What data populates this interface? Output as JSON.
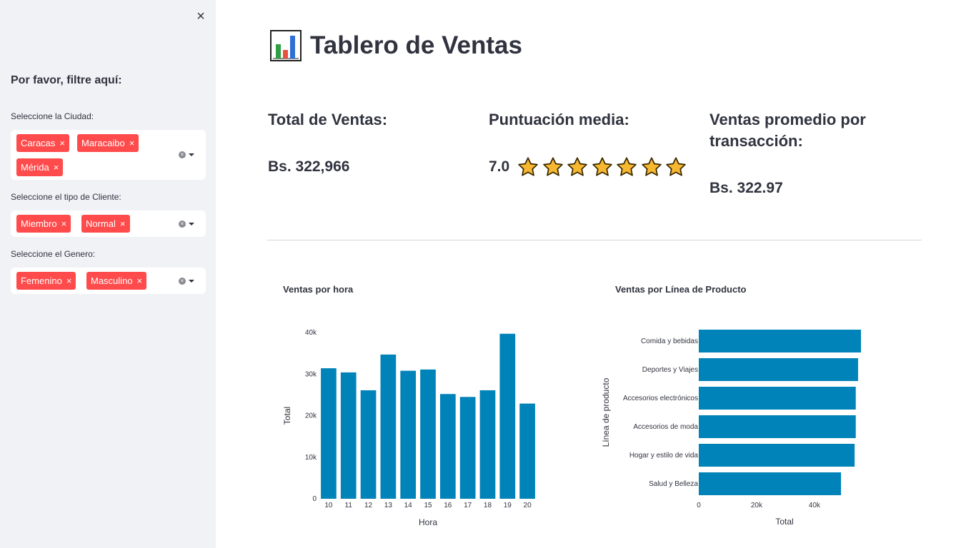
{
  "sidebar": {
    "header": "Por favor, filtre aquí:",
    "close_icon": "close-icon",
    "filters": [
      {
        "label": "Seleccione la Ciudad:",
        "selected": [
          "Caracas",
          "Maracaibo",
          "Mérida"
        ]
      },
      {
        "label": "Seleccione el tipo de Cliente:",
        "selected": [
          "Miembro",
          "Normal"
        ]
      },
      {
        "label": "Seleccione el Genero:",
        "selected": [
          "Femenino",
          "Masculino"
        ]
      }
    ],
    "tag_remove_glyph": "×",
    "tag_color": "#ff4b4b"
  },
  "main": {
    "title_icon": "bar-chart-icon",
    "title": "Tablero de Ventas",
    "metrics": {
      "total_label": "Total de Ventas:",
      "total_value": "Bs. 322,966",
      "rating_label": "Puntuación media:",
      "rating_value": "7.0",
      "rating_stars": 7,
      "avg_label": "Ventas promedio por transacción:",
      "avg_value": "Bs. 322.97"
    }
  },
  "chart_data": [
    {
      "type": "bar",
      "title": "Ventas por hora",
      "xlabel": "Hora",
      "ylabel": "Total",
      "categories": [
        "10",
        "11",
        "12",
        "13",
        "14",
        "15",
        "16",
        "17",
        "18",
        "19",
        "20"
      ],
      "values": [
        31400,
        30400,
        26100,
        34700,
        30800,
        31100,
        25200,
        24500,
        26100,
        39700,
        22900
      ],
      "ylim": [
        0,
        40000
      ],
      "yticks": [
        "0",
        "10k",
        "20k",
        "30k",
        "40k"
      ],
      "color": "#0083b8"
    },
    {
      "type": "bar",
      "orientation": "horizontal",
      "title": "Ventas por Línea de Producto",
      "xlabel": "Total",
      "ylabel": "Línea de producto",
      "categories": [
        "Comida y bebidas",
        "Deportes y Viajes",
        "Accesorios electrónicos",
        "Accesorios de moda",
        "Hogar y estilo de vida",
        "Salud y Belleza"
      ],
      "values": [
        56100,
        55100,
        54300,
        54300,
        53900,
        49200
      ],
      "xlim": [
        0,
        56100
      ],
      "xticks": [
        "0",
        "20k",
        "40k"
      ],
      "color": "#0083b8"
    }
  ]
}
